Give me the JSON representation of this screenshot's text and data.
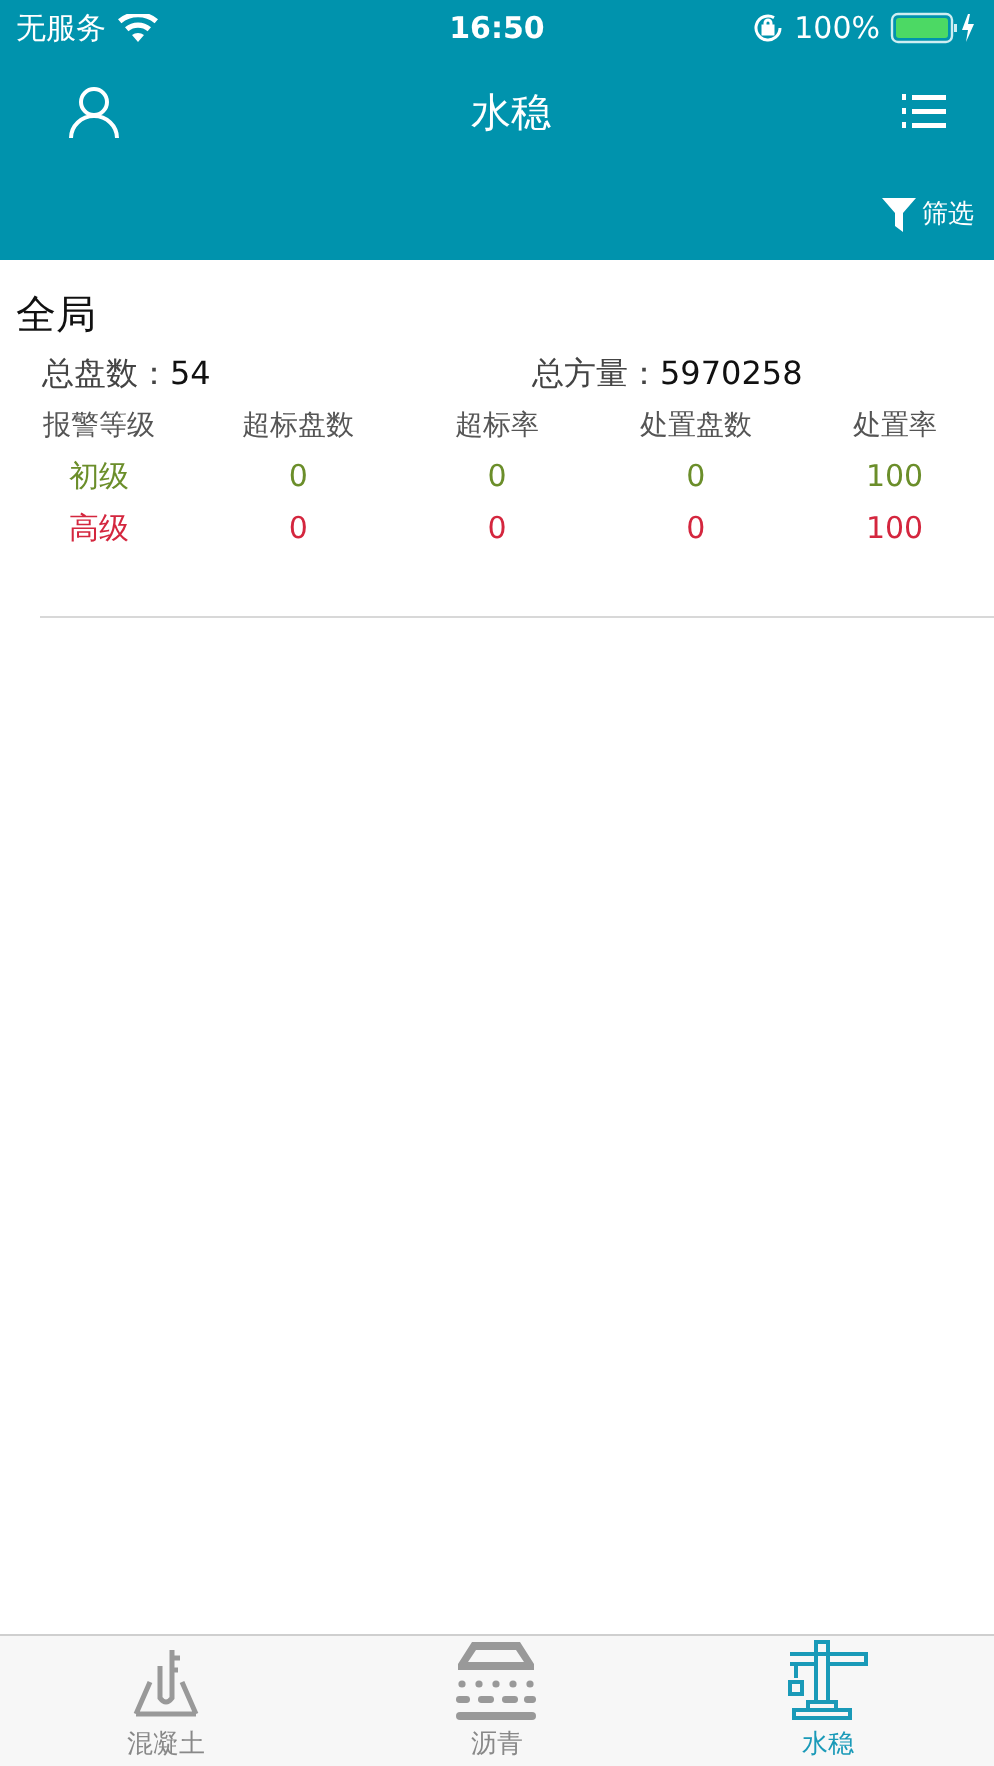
{
  "status_bar": {
    "carrier": "无服务",
    "time": "16:50",
    "battery": "100%"
  },
  "nav": {
    "title": "水稳",
    "filter": "筛选"
  },
  "section": {
    "title": "全局",
    "summary": [
      {
        "label": "总盘数：",
        "value": "54"
      },
      {
        "label": "总方量：",
        "value": "5970258"
      }
    ],
    "table": {
      "columns": [
        "报警等级",
        "超标盘数",
        "超标率",
        "处置盘数",
        "处置率"
      ],
      "rows": [
        {
          "color": "#6b8e2a",
          "cells": [
            "初级",
            "0",
            "0",
            "0",
            "100"
          ]
        },
        {
          "color": "#d4263e",
          "cells": [
            "高级",
            "0",
            "0",
            "0",
            "100"
          ]
        }
      ]
    }
  },
  "tab_bar": [
    {
      "kind": "concrete",
      "label": "混凝土",
      "selected": false
    },
    {
      "kind": "asphalt",
      "label": "沥青",
      "selected": false
    },
    {
      "kind": "crane",
      "label": "水稳",
      "selected": true
    }
  ]
}
